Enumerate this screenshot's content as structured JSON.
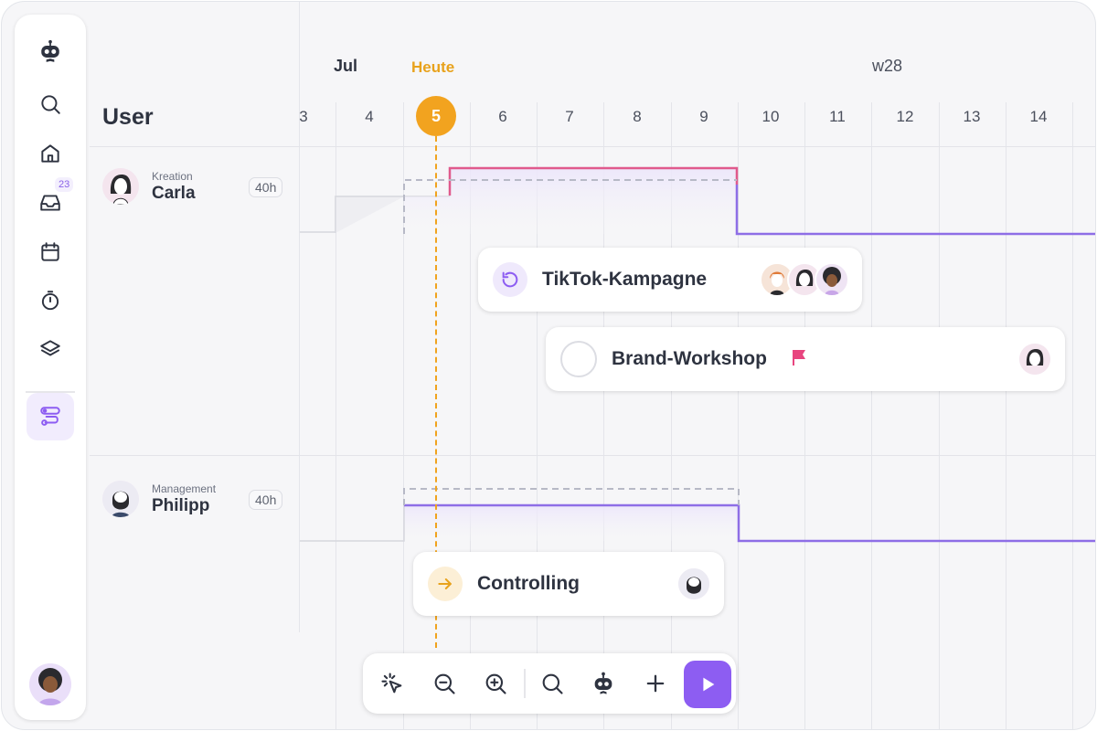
{
  "sidebar": {
    "inbox_badge": "23",
    "items": [
      {
        "icon": "bot-logo-icon"
      },
      {
        "icon": "search-icon"
      },
      {
        "icon": "home-icon"
      },
      {
        "icon": "inbox-icon"
      },
      {
        "icon": "calendar-icon"
      },
      {
        "icon": "stopwatch-icon"
      },
      {
        "icon": "layers-icon"
      },
      {
        "icon": "workflow-icon"
      }
    ]
  },
  "header": {
    "user_heading": "User",
    "month_label": "Jul",
    "today_label": "Heute",
    "week_label": "w28",
    "days": [
      "3",
      "4",
      "5",
      "6",
      "7",
      "8",
      "9",
      "10",
      "11",
      "12",
      "13",
      "14"
    ],
    "today_day": "5"
  },
  "users": [
    {
      "role": "Kreation",
      "name": "Carla",
      "hours": "40h"
    },
    {
      "role": "Management",
      "name": "Philipp",
      "hours": "40h"
    }
  ],
  "tasks": [
    {
      "title": "TikTok-Kampagne",
      "status_icon": "recurring-icon"
    },
    {
      "title": "Brand-Workshop",
      "status_icon": "circle-outline-icon",
      "flag": "flag-icon"
    },
    {
      "title": "Controlling",
      "status_icon": "arrow-right-icon"
    }
  ],
  "colors": {
    "accent": "#8d5df2",
    "today": "#f2a31f",
    "overload": "#e05a8c",
    "capacity": "#8e6ee6"
  },
  "toolbar": {
    "icons": [
      "pointer-sparkle-icon",
      "zoom-out-icon",
      "zoom-in-icon",
      "search-icon",
      "bot-icon",
      "plus-icon",
      "play-icon"
    ]
  }
}
